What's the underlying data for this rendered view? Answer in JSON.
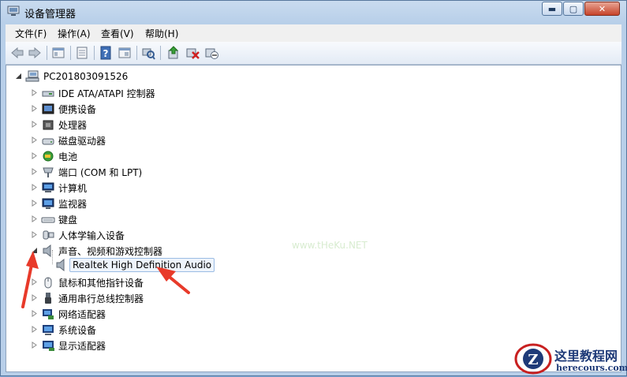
{
  "window": {
    "title": "设备管理器"
  },
  "title_controls": {
    "minimize": "▬",
    "maximize": "▢",
    "close": "✕"
  },
  "menu": [
    {
      "label": "文件(F)"
    },
    {
      "label": "操作(A)"
    },
    {
      "label": "查看(V)"
    },
    {
      "label": "帮助(H)"
    }
  ],
  "toolbar": [
    "back-icon",
    "forward-icon",
    "properties-icon",
    "console-icon",
    "help-icon",
    "view-icon",
    "scan-icon",
    "update-driver-icon",
    "uninstall-icon",
    "disable-icon"
  ],
  "tree": {
    "root": "PC201803091526",
    "items": [
      {
        "label": "IDE ATA/ATAPI 控制器",
        "icon": "ide-icon"
      },
      {
        "label": "便携设备",
        "icon": "portable-device-icon"
      },
      {
        "label": "处理器",
        "icon": "processor-icon"
      },
      {
        "label": "磁盘驱动器",
        "icon": "disk-drive-icon"
      },
      {
        "label": "电池",
        "icon": "battery-icon"
      },
      {
        "label": "端口 (COM 和 LPT)",
        "icon": "port-icon"
      },
      {
        "label": "计算机",
        "icon": "computer-icon"
      },
      {
        "label": "监视器",
        "icon": "monitor-icon"
      },
      {
        "label": "键盘",
        "icon": "keyboard-icon"
      },
      {
        "label": "人体学输入设备",
        "icon": "hid-icon"
      },
      {
        "label": "声音、视频和游戏控制器",
        "icon": "speaker-icon",
        "expanded": true
      },
      {
        "label": "鼠标和其他指针设备",
        "icon": "mouse-icon"
      },
      {
        "label": "通用串行总线控制器",
        "icon": "usb-icon"
      },
      {
        "label": "网络适配器",
        "icon": "network-icon"
      },
      {
        "label": "系统设备",
        "icon": "system-device-icon"
      },
      {
        "label": "显示适配器",
        "icon": "display-adapter-icon"
      }
    ],
    "child": "Realtek High Definition Audio"
  },
  "watermark": {
    "line1": "这里教程网",
    "line2": "herecours.com"
  }
}
